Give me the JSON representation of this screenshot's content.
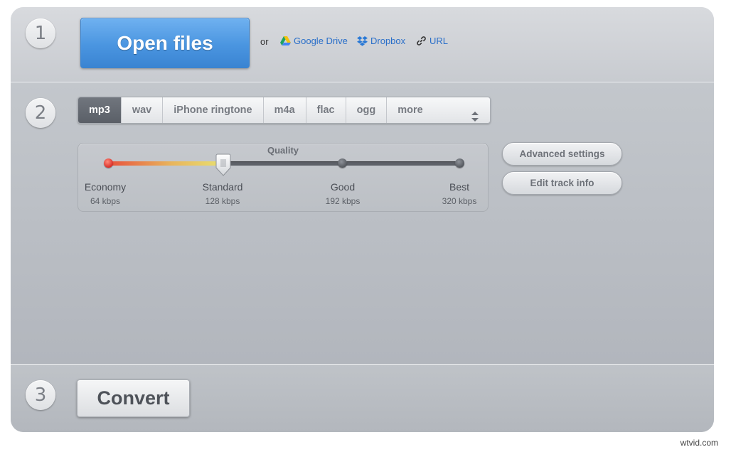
{
  "steps": {
    "one": "1",
    "two": "2",
    "three": "3"
  },
  "source": {
    "open_label": "Open files",
    "or_label": "or",
    "links": [
      {
        "label": "Google Drive",
        "icon": "google-drive-icon"
      },
      {
        "label": "Dropbox",
        "icon": "dropbox-icon"
      },
      {
        "label": "URL",
        "icon": "link-icon"
      }
    ]
  },
  "formats": {
    "tabs": [
      "mp3",
      "wav",
      "iPhone ringtone",
      "m4a",
      "flac",
      "ogg",
      "more"
    ],
    "selected": "mp3"
  },
  "quality": {
    "title": "Quality",
    "levels": [
      {
        "label": "Economy",
        "bitrate": "64 kbps"
      },
      {
        "label": "Standard",
        "bitrate": "128 kbps"
      },
      {
        "label": "Good",
        "bitrate": "192 kbps"
      },
      {
        "label": "Best",
        "bitrate": "320 kbps"
      }
    ],
    "selected_index": 1
  },
  "settings": {
    "advanced_label": "Advanced settings",
    "track_info_label": "Edit track info"
  },
  "convert": {
    "label": "Convert"
  },
  "watermark": "wtvid.com",
  "colors": {
    "accent_blue": "#4a95e0",
    "active_tab": "#5f646c",
    "link": "#2a6fc9"
  }
}
